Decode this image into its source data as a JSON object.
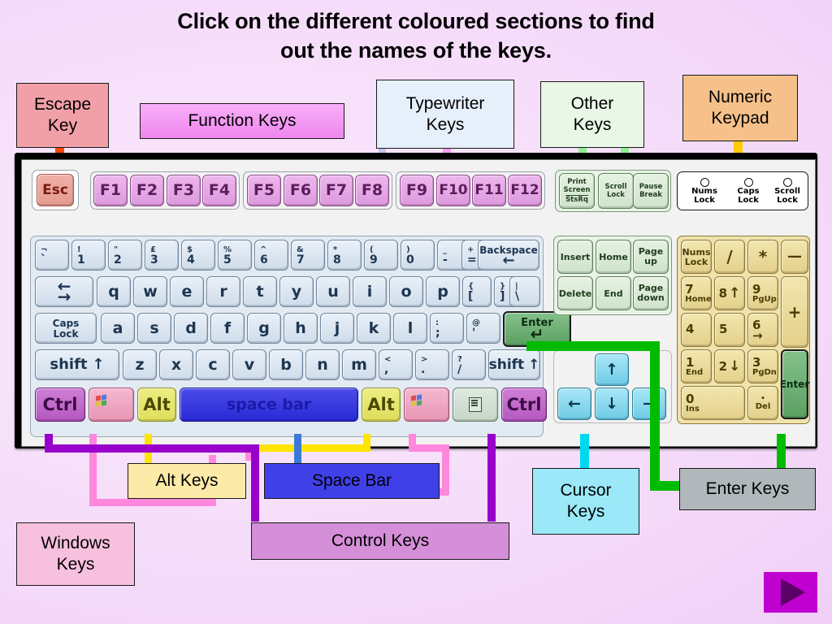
{
  "title": {
    "line1": "Click on the different coloured sections to find",
    "line2": "out the names of the keys."
  },
  "callouts": {
    "escape": {
      "label": "Escape\nKey",
      "color": "#f2a0a8",
      "connector": "#ff4400"
    },
    "function": {
      "label": "Function Keys",
      "color": "#f49cf4",
      "connector": "#f49cf4"
    },
    "typewriter": {
      "label": "Typewriter\nKeys",
      "color": "#e6f0fb",
      "connector": "#c3c3ee"
    },
    "other": {
      "label": "Other\nKeys",
      "color": "#e9f8e6",
      "connector": "#8cf08c"
    },
    "numeric": {
      "label": "Numeric\nKeypad",
      "color": "#f5c08a",
      "connector": "#ffcc00"
    },
    "alt": {
      "label": "Alt Keys",
      "color": "#fbeaa8",
      "connector": "#ffe400"
    },
    "space": {
      "label": "Space Bar",
      "color": "#4040e8",
      "connector": "#3a7ad6"
    },
    "windows": {
      "label": "Windows\nKeys",
      "color": "#f7c0de",
      "connector": "#ff88dd"
    },
    "control": {
      "label": "Control Keys",
      "color": "#d48fd8",
      "connector": "#9900cc"
    },
    "cursor": {
      "label": "Cursor\nKeys",
      "color": "#9ae8f8",
      "connector": "#00d8f0"
    },
    "enter": {
      "label": "Enter Keys",
      "color": "#b0b8bc",
      "connector": "#00bb00"
    }
  },
  "keyboard": {
    "escape_key": "Esc",
    "function_keys_group1": [
      "F1",
      "F2",
      "F3",
      "F4"
    ],
    "function_keys_group2": [
      "F5",
      "F6",
      "F7",
      "F8"
    ],
    "function_keys_group3": [
      "F9",
      "F10",
      "F11",
      "F12"
    ],
    "system_keys": [
      {
        "top": "Print\nScreen",
        "bottom": "StsRq"
      },
      {
        "top": "Scroll",
        "bottom": "Lock"
      },
      {
        "top": "Pause",
        "bottom": "Break"
      }
    ],
    "leds": [
      {
        "line1": "Nums",
        "line2": "Lock"
      },
      {
        "line1": "Caps",
        "line2": "Lock"
      },
      {
        "line1": "Scroll",
        "line2": "Lock"
      }
    ],
    "number_row": [
      {
        "upper": "¬",
        "lower": "`"
      },
      {
        "upper": "!",
        "lower": "1"
      },
      {
        "upper": "\"",
        "lower": "2"
      },
      {
        "upper": "£",
        "lower": "3"
      },
      {
        "upper": "$",
        "lower": "4"
      },
      {
        "upper": "%",
        "lower": "5"
      },
      {
        "upper": "^",
        "lower": "6"
      },
      {
        "upper": "&",
        "lower": "7"
      },
      {
        "upper": "*",
        "lower": "8"
      },
      {
        "upper": "(",
        "lower": "9"
      },
      {
        "upper": ")",
        "lower": "0"
      },
      {
        "upper": "_",
        "lower": "-"
      },
      {
        "upper": "+",
        "lower": "="
      }
    ],
    "backspace": {
      "label": "Backspace",
      "arrow": "←"
    },
    "tab": {
      "arrow_left": "←",
      "arrow_right": "→"
    },
    "qwerty_row": [
      "q",
      "w",
      "e",
      "r",
      "t",
      "y",
      "u",
      "i",
      "o",
      "p"
    ],
    "qwerty_symbols": [
      {
        "upper": "{",
        "lower": "["
      },
      {
        "upper": "}",
        "lower": "]"
      },
      {
        "upper": "|",
        "lower": "\\"
      }
    ],
    "caps_lock": {
      "line1": "Caps",
      "line2": "Lock"
    },
    "home_row": [
      "a",
      "s",
      "d",
      "f",
      "g",
      "h",
      "j",
      "k",
      "l"
    ],
    "home_symbols": [
      {
        "upper": ":",
        "lower": ";"
      },
      {
        "upper": "@",
        "lower": "'"
      }
    ],
    "enter_key": {
      "label": "Enter",
      "arrow": "↵"
    },
    "shift_left": {
      "label": "shift",
      "arrow": "↑"
    },
    "bottom_row_letters": [
      "z",
      "x",
      "c",
      "v",
      "b",
      "n",
      "m"
    ],
    "bottom_symbols": [
      {
        "upper": "<",
        "lower": ","
      },
      {
        "upper": ">",
        "lower": "."
      },
      {
        "upper": "?",
        "lower": "/"
      }
    ],
    "shift_right": {
      "label": "shift",
      "arrow": "↑"
    },
    "ctrl_left": "Ctrl",
    "ctrl_right": "Ctrl",
    "alt_left": "Alt",
    "alt_right": "Alt",
    "space_bar": "space bar",
    "windows_key": "windows-logo",
    "menu_key": "menu-icon",
    "nav_cluster": [
      [
        "Insert",
        "Home",
        "Page\nup"
      ],
      [
        "Delete",
        "End",
        "Page\ndown"
      ]
    ],
    "cursor_keys": {
      "up": "↑",
      "left": "←",
      "down": "↓",
      "right": "→"
    },
    "keypad": {
      "num_lock": {
        "line1": "Nums",
        "line2": "Lock"
      },
      "divide": "/",
      "multiply": "*",
      "minus": "—",
      "plus": "+",
      "enter": "Enter",
      "k7": {
        "num": "7",
        "sub": "Home"
      },
      "k8": {
        "num": "8",
        "sub": "↑"
      },
      "k9": {
        "num": "9",
        "sub": "PgUp"
      },
      "k4": {
        "num": "4",
        "sub": ""
      },
      "k5": {
        "num": "5",
        "sub": ""
      },
      "k6": {
        "num": "6",
        "sub": "→"
      },
      "k1": {
        "num": "1",
        "sub": "End"
      },
      "k2": {
        "num": "2",
        "sub": "↓"
      },
      "k3": {
        "num": "3",
        "sub": "PgDn"
      },
      "k0": {
        "num": "0",
        "sub": "Ins"
      },
      "kdot": {
        "num": "·",
        "sub": "Del"
      }
    }
  },
  "nav": {
    "next_button": "play-next"
  }
}
